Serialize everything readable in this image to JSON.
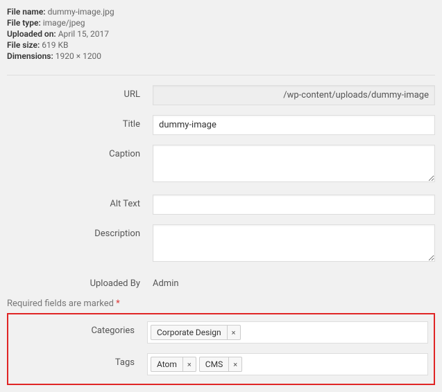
{
  "meta": {
    "file_name_label": "File name:",
    "file_name": "dummy-image.jpg",
    "file_type_label": "File type:",
    "file_type": "image/jpeg",
    "uploaded_on_label": "Uploaded on:",
    "uploaded_on": "April 15, 2017",
    "file_size_label": "File size:",
    "file_size": "619 KB",
    "dimensions_label": "Dimensions:",
    "dimensions": "1920 × 1200"
  },
  "fields": {
    "url_label": "URL",
    "url_value": "/wp-content/uploads/dummy-image",
    "title_label": "Title",
    "title_value": "dummy-image",
    "caption_label": "Caption",
    "caption_value": "",
    "alt_label": "Alt Text",
    "alt_value": "",
    "description_label": "Description",
    "description_value": "",
    "uploaded_by_label": "Uploaded By",
    "uploaded_by_value": "Admin"
  },
  "required_note_text": "Required fields are marked ",
  "required_note_ast": "*",
  "categories": {
    "label": "Categories",
    "items": [
      "Corporate Design"
    ]
  },
  "tags": {
    "label": "Tags",
    "items": [
      "Atom",
      "CMS"
    ]
  },
  "icons": {
    "remove": "×"
  }
}
